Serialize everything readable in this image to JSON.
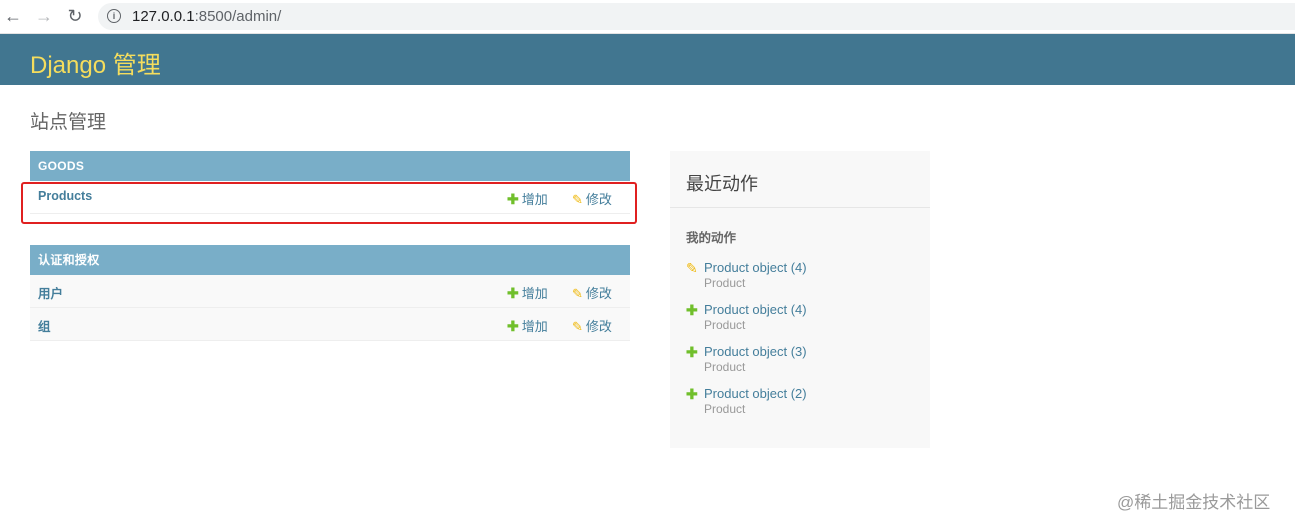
{
  "browser": {
    "back_icon": "←",
    "forward_icon": "→",
    "reload_icon": "↻",
    "info_icon": "i",
    "url_host": "127.0.0.1",
    "url_rest": ":8500/admin/"
  },
  "header": {
    "title": "Django 管理"
  },
  "page_title": "站点管理",
  "modules": [
    {
      "caption": "GOODS",
      "rows": [
        {
          "name": "Products",
          "add_label": "增加",
          "change_label": "修改"
        }
      ]
    },
    {
      "caption": "认证和授权",
      "rows": [
        {
          "name": "用户",
          "add_label": "增加",
          "change_label": "修改"
        },
        {
          "name": "组",
          "add_label": "增加",
          "change_label": "修改"
        }
      ]
    }
  ],
  "icons": {
    "add": "✚",
    "change": "✎"
  },
  "recent_actions": {
    "title": "最近动作",
    "subtitle": "我的动作",
    "items": [
      {
        "kind": "change",
        "icon": "✎",
        "label": "Product object (4)",
        "type": "Product"
      },
      {
        "kind": "add",
        "icon": "✚",
        "label": "Product object (4)",
        "type": "Product"
      },
      {
        "kind": "add",
        "icon": "✚",
        "label": "Product object (3)",
        "type": "Product"
      },
      {
        "kind": "add",
        "icon": "✚",
        "label": "Product object (2)",
        "type": "Product"
      }
    ]
  },
  "watermark": "@稀土掘金技术社区",
  "colors": {
    "header_bg": "#417690",
    "header_title": "#f5dd5d",
    "caption_bg": "#79aec8",
    "link": "#447e9b",
    "add_icon": "#70bf2b",
    "change_icon": "#efb80b",
    "highlight": "#e02020"
  }
}
